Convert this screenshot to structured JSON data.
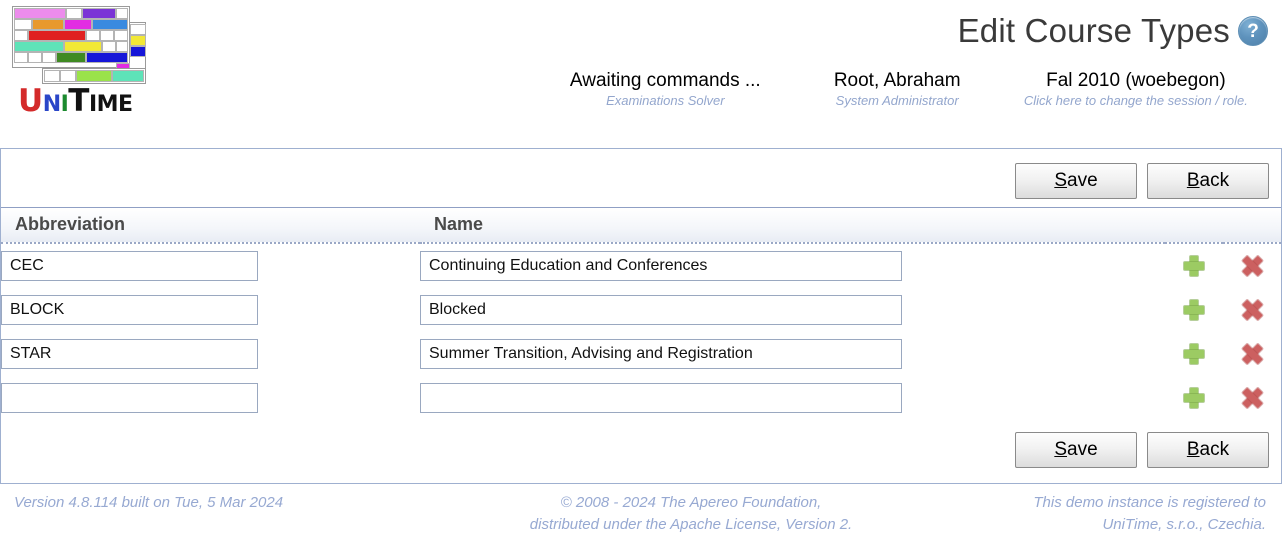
{
  "app": {
    "logo_text_parts": [
      "U",
      "N",
      "I",
      "T",
      "IME"
    ],
    "logo_alt": "UniTime"
  },
  "header": {
    "title": "Edit Course Types",
    "help_icon": "help-question-icon",
    "status": [
      {
        "main": "Awaiting commands ...",
        "sub": "Examinations Solver"
      },
      {
        "main": "Root, Abraham",
        "sub": "System Administrator"
      },
      {
        "main": "Fal 2010 (woebegon)",
        "sub": "Click here to change the session / role."
      }
    ]
  },
  "toolbar": {
    "save_label_accel": "S",
    "save_label_rest": "ave",
    "back_label_accel": "B",
    "back_label_rest": "ack"
  },
  "table": {
    "columns": [
      "Abbreviation",
      "Name"
    ],
    "rows": [
      {
        "abbreviation": "CEC",
        "name": "Continuing Education and Conferences"
      },
      {
        "abbreviation": "BLOCK",
        "name": "Blocked"
      },
      {
        "abbreviation": "STAR",
        "name": "Summer Transition, Advising and Registration"
      },
      {
        "abbreviation": "",
        "name": ""
      }
    ],
    "row_actions": {
      "add_icon": "plus-icon",
      "delete_icon": "delete-x-icon"
    },
    "input_placeholder": ""
  },
  "footer": {
    "version": "Version 4.8.114 built on Tue, 5 Mar 2024",
    "copyright_line1": "© 2008 - 2024 The Apereo Foundation,",
    "copyright_line2": "distributed under the Apache License, Version 2.",
    "registered_line1": "This demo instance is registered to",
    "registered_line2": "UniTime, s.r.o., Czechia."
  },
  "colors": {
    "accent_border": "#9fb0d0",
    "footer_text": "#97a9d2",
    "header_band": "#e8ecf4",
    "add_icon": "#9ccb63",
    "delete_icon": "#cc6060",
    "help_icon": "#5f93bd"
  }
}
